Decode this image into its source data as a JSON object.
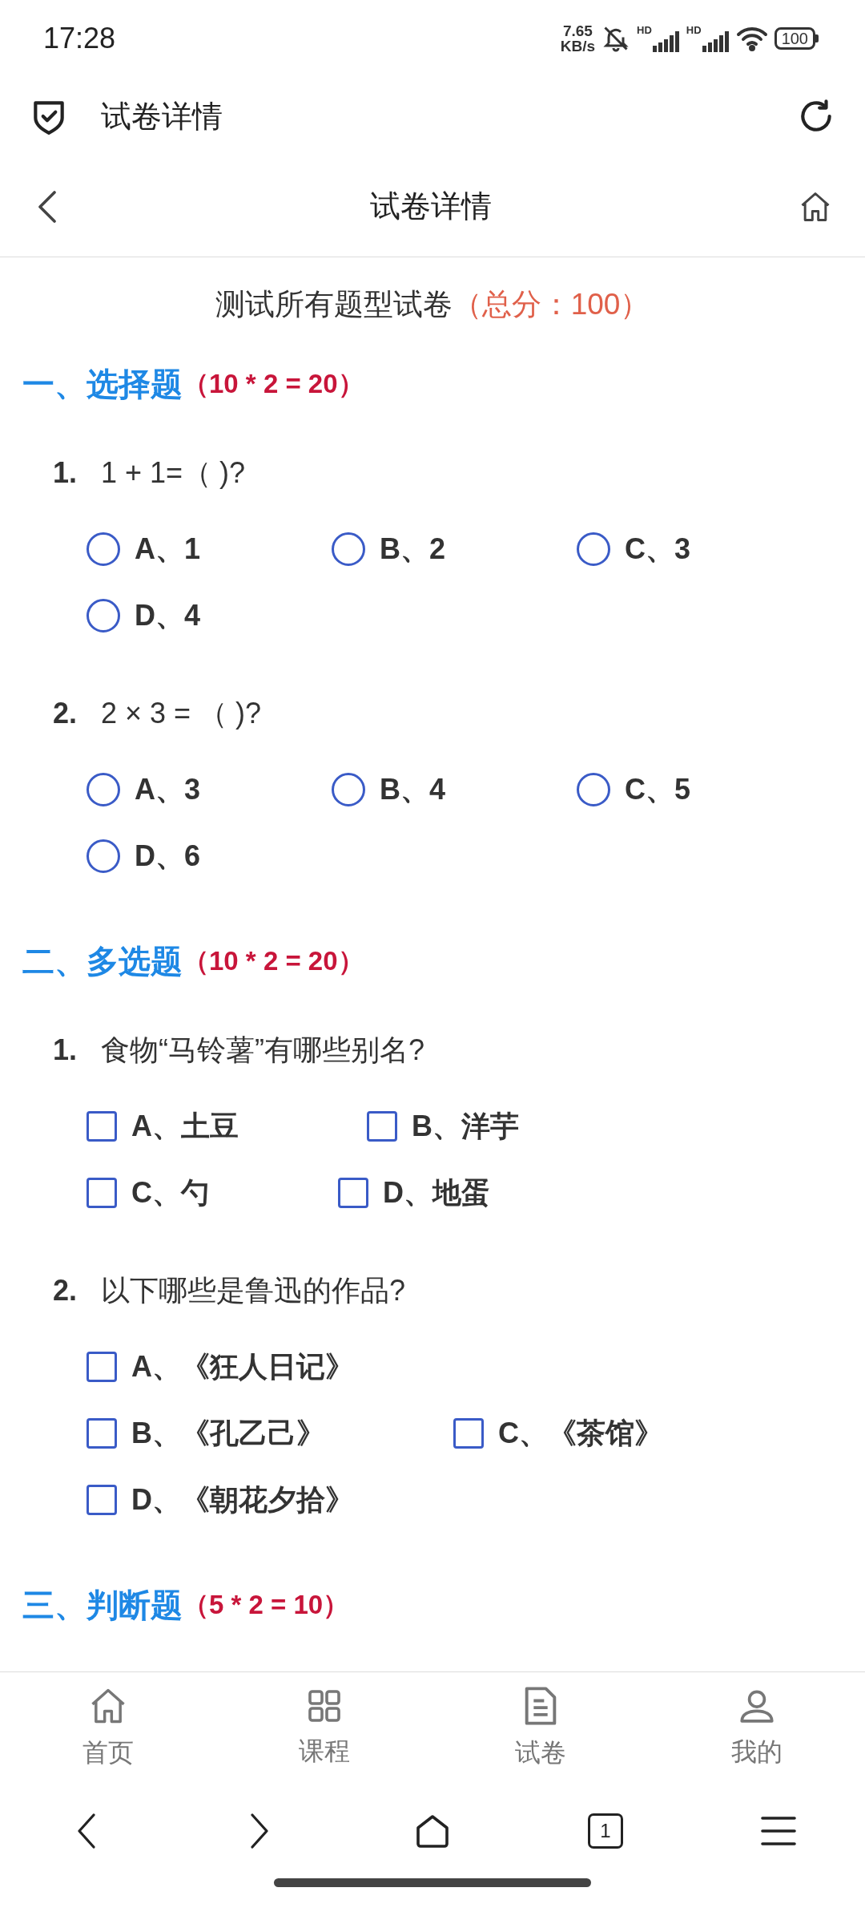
{
  "status_bar": {
    "time": "17:28",
    "speed_value": "7.65",
    "speed_unit": "KB/s",
    "signal_labels": [
      "HD",
      "HD"
    ],
    "battery": "100"
  },
  "app_bar": {
    "title": "试卷详情"
  },
  "nav_bar": {
    "title": "试卷详情"
  },
  "paper": {
    "title": "测试所有题型试卷",
    "total": "（总分：100）"
  },
  "sections": [
    {
      "heading": "一、选择题",
      "score": "（10 * 2 = 20）",
      "kind": "single",
      "questions": [
        {
          "number": "1.",
          "text": "1 + 1=（ )?",
          "options": [
            {
              "label": "A、1",
              "selected": false
            },
            {
              "label": "B、2",
              "selected": false
            },
            {
              "label": "C、3",
              "selected": false
            },
            {
              "label": "D、4",
              "selected": false
            }
          ]
        },
        {
          "number": "2.",
          "text": "2 × 3 = （ )?",
          "options": [
            {
              "label": "A、3",
              "selected": false
            },
            {
              "label": "B、4",
              "selected": false
            },
            {
              "label": "C、5",
              "selected": false
            },
            {
              "label": "D、6",
              "selected": false
            }
          ]
        }
      ]
    },
    {
      "heading": "二、多选题",
      "score": "（10 * 2 = 20）",
      "kind": "multiple",
      "questions": [
        {
          "number": "1.",
          "text": "食物“马铃薯”有哪些别名?",
          "options": [
            {
              "label": "A、土豆",
              "checked": false
            },
            {
              "label": "B、洋芋",
              "checked": false
            },
            {
              "label": "C、勺",
              "checked": false
            },
            {
              "label": "D、地蛋",
              "checked": false
            }
          ]
        },
        {
          "number": "2.",
          "text": "以下哪些是鲁迅的作品?",
          "options": [
            {
              "label": "A、《狂人日记》",
              "checked": false
            },
            {
              "label": "B、《孔乙己》",
              "checked": false
            },
            {
              "label": "C、《茶馆》",
              "checked": false
            },
            {
              "label": "D、《朝花夕拾》",
              "checked": false
            }
          ]
        }
      ]
    },
    {
      "heading": "三、判断题",
      "score": "（5 * 2 = 10）"
    }
  ],
  "bottom_tabs": [
    {
      "label": "首页",
      "selected": false
    },
    {
      "label": "课程",
      "selected": false
    },
    {
      "label": "试卷",
      "selected": false
    },
    {
      "label": "我的",
      "selected": false
    }
  ],
  "browser_bar": {
    "tab_count": "1"
  }
}
